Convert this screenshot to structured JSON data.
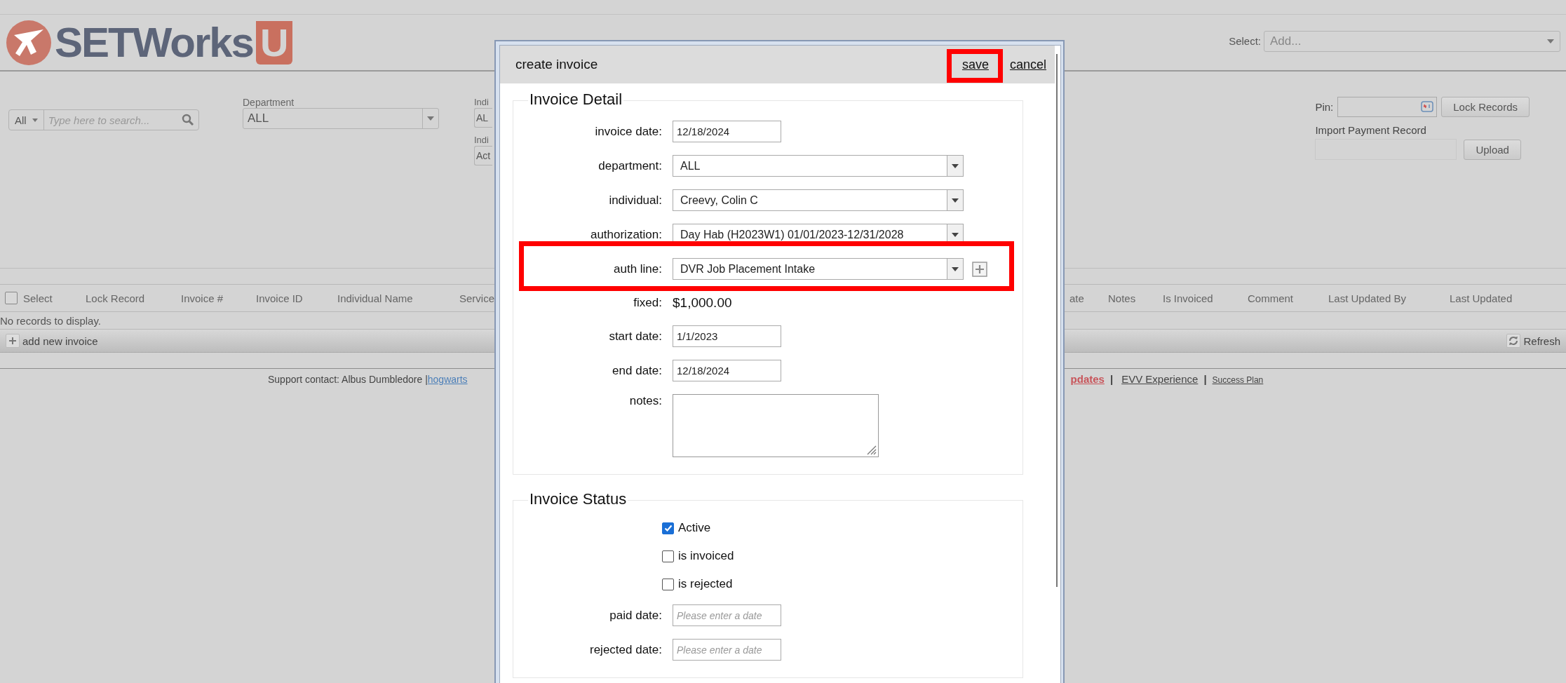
{
  "header": {
    "logo": {
      "name": "SETWorks",
      "suffix": "U"
    },
    "select": {
      "label": "Select:",
      "placeholder": "Add..."
    }
  },
  "filters": {
    "search": {
      "scope": "All",
      "placeholder": "Type here to search..."
    },
    "department": {
      "label": "Department",
      "value": "ALL"
    },
    "cut_filters": [
      {
        "label": "Indi",
        "value": "AL"
      },
      {
        "label": "Indi",
        "value": "Act"
      }
    ],
    "pin": {
      "label": "Pin:"
    },
    "lock_button": "Lock Records",
    "import": {
      "label": "Import Payment Record"
    },
    "upload_button": "Upload"
  },
  "table": {
    "select_all": {
      "label": "Select",
      "checked": false
    },
    "columns": [
      "Lock Record",
      "Invoice #",
      "Invoice ID",
      "Individual Name",
      "Service",
      "ate",
      "Notes",
      "Is Invoiced",
      "Comment",
      "Last Updated By",
      "Last Updated"
    ],
    "empty_message": "No records to display.",
    "add_button": "add new invoice",
    "refresh_button": "Refresh"
  },
  "footer": {
    "support": "Support contact: Albus Dumbledore |",
    "items": [
      {
        "kind": "link",
        "text": "hogwarts"
      },
      {
        "kind": "alert-link",
        "text": "pdates"
      },
      {
        "kind": "separator",
        "text": "|"
      },
      {
        "kind": "link",
        "text": "EVV Experience"
      },
      {
        "kind": "separator",
        "text": "|"
      },
      {
        "kind": "small-link",
        "text": "Success Plan"
      }
    ]
  },
  "modal": {
    "title": "create invoice",
    "actions": [
      {
        "label": "save",
        "highlighted": true
      },
      {
        "label": "cancel",
        "highlighted": false
      }
    ],
    "sections": [
      {
        "legend": "Invoice Detail",
        "fields": [
          {
            "kind": "input",
            "label": "invoice date:",
            "value": "12/18/2024"
          },
          {
            "kind": "select",
            "label": "department:",
            "value": "ALL"
          },
          {
            "kind": "select",
            "label": "individual:",
            "value": "Creevy, Colin C"
          },
          {
            "kind": "select",
            "label": "authorization:",
            "value": "Day Hab (H2023W1) 01/01/2023-12/31/2028"
          },
          {
            "kind": "select-add",
            "label": "auth line:",
            "value": "DVR Job Placement Intake",
            "highlighted": true
          },
          {
            "kind": "text",
            "label": "fixed:",
            "value": "$1,000.00"
          },
          {
            "kind": "input",
            "label": "start date:",
            "value": "1/1/2023"
          },
          {
            "kind": "input",
            "label": "end date:",
            "value": "12/18/2024"
          },
          {
            "kind": "textarea",
            "label": "notes:"
          }
        ]
      },
      {
        "legend": "Invoice Status",
        "fields": [
          {
            "kind": "checkbox",
            "label": "Active",
            "checked": true
          },
          {
            "kind": "checkbox",
            "label": "is invoiced",
            "checked": false
          },
          {
            "kind": "checkbox",
            "label": "is rejected",
            "checked": false
          },
          {
            "kind": "input",
            "label": "paid date:",
            "placeholder": "Please enter a date"
          },
          {
            "kind": "input",
            "label": "rejected date:",
            "placeholder": "Please enter a date"
          }
        ]
      }
    ]
  }
}
